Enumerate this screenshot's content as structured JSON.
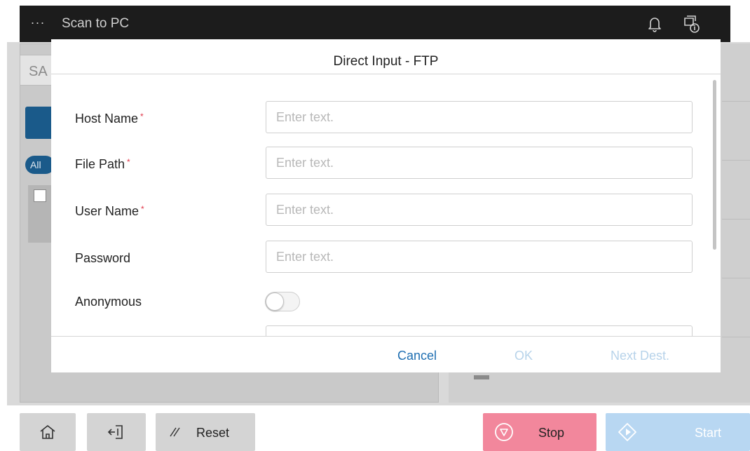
{
  "app": {
    "menu_icon": "more-icon",
    "menu_glyph": "···",
    "title": "Scan to PC",
    "notification_icon": "bell-icon",
    "status_icon": "device-info-icon"
  },
  "background": {
    "search_text": "SA",
    "filter_pill": "All"
  },
  "dialog": {
    "title": "Direct Input - FTP",
    "required_mark": "*",
    "fields": [
      {
        "label": "Host Name",
        "required": true,
        "placeholder": "Enter text.",
        "value": ""
      },
      {
        "label": "File Path",
        "required": true,
        "placeholder": "Enter text.",
        "value": ""
      },
      {
        "label": "User Name",
        "required": true,
        "placeholder": "Enter text.",
        "value": ""
      },
      {
        "label": "Password",
        "required": false,
        "placeholder": "Enter text.",
        "value": ""
      }
    ],
    "anonymous": {
      "label": "Anonymous",
      "on": false
    },
    "footer": {
      "cancel": "Cancel",
      "ok": "OK",
      "next": "Next Dest."
    }
  },
  "bottom_bar": {
    "home_icon": "home-icon",
    "logout_icon": "logout-icon",
    "reset_label": "Reset",
    "reset_icon": "reset-icon",
    "stop_label": "Stop",
    "stop_icon": "stop-icon",
    "start_label": "Start",
    "start_icon": "start-icon"
  },
  "colors": {
    "accent": "#1f6fb2",
    "required": "#e0384a",
    "stop": "#f2879c",
    "start": "#b8d7f2",
    "topbar": "#1c1c1c"
  }
}
